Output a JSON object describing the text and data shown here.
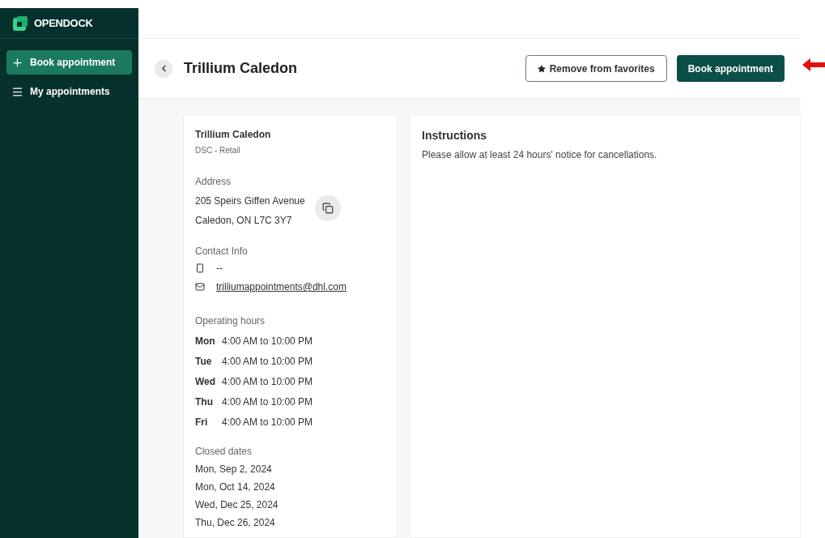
{
  "sidebar": {
    "logo": "OPENDOCK",
    "items": [
      {
        "label": "Book appointment",
        "selected": true
      },
      {
        "label": "My appointments",
        "selected": false
      }
    ]
  },
  "header": {
    "title": "Trillium Caledon",
    "buttons": [
      {
        "label": "Remove from favorites",
        "kind": "outline"
      },
      {
        "label": "Book appointment",
        "kind": "primary"
      }
    ]
  },
  "details": {
    "name": "Trillium Caledon",
    "subtitle": "DSC - Retail",
    "address_label": "Address",
    "address_lines": [
      "205 Speirs Giffen Avenue",
      "Caledon, ON L7C 3Y7"
    ],
    "contact_label": "Contact Info",
    "phone": "--",
    "email": "trilliumappointments@dhl.com",
    "hours_label": "Operating hours",
    "hours": [
      {
        "day": "Mon",
        "time": "4:00 AM to 10:00 PM"
      },
      {
        "day": "Tue",
        "time": "4:00 AM to 10:00 PM"
      },
      {
        "day": "Wed",
        "time": "4:00 AM to 10:00 PM"
      },
      {
        "day": "Thu",
        "time": "4:00 AM to 10:00 PM"
      },
      {
        "day": "Fri",
        "time": "4:00 AM to 10:00 PM"
      }
    ],
    "closed_label": "Closed dates",
    "closed_dates": [
      "Mon, Sep 2, 2024",
      "Mon, Oct 14, 2024",
      "Wed, Dec 25, 2024",
      "Thu, Dec 26, 2024"
    ]
  },
  "instructions": {
    "title": "Instructions",
    "text": "Please allow at least 24 hours' notice for cancellations."
  }
}
